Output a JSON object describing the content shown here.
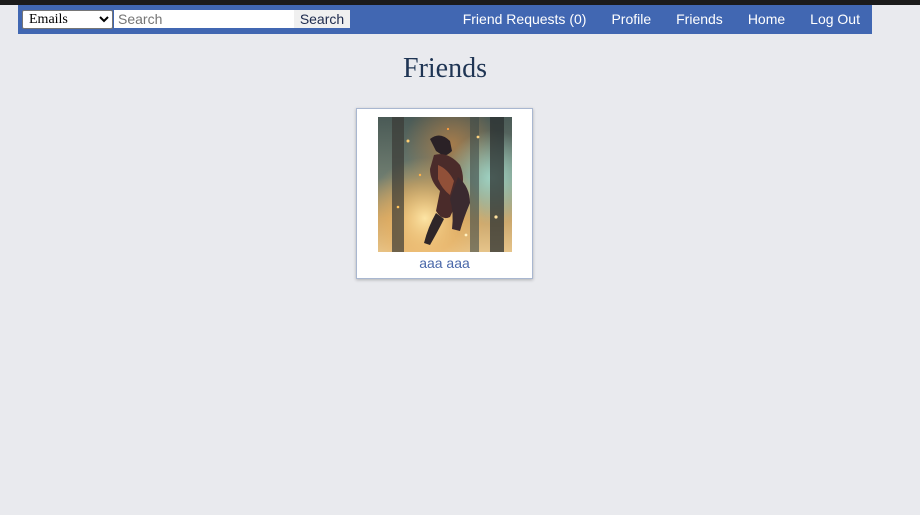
{
  "header": {
    "search": {
      "type_options": [
        "Emails"
      ],
      "selected_type": "Emails",
      "placeholder": "Search",
      "value": "",
      "button_label": "Search"
    },
    "nav": [
      {
        "label": "Friend Requests (0)"
      },
      {
        "label": "Profile"
      },
      {
        "label": "Friends"
      },
      {
        "label": "Home"
      },
      {
        "label": "Log Out"
      }
    ]
  },
  "main": {
    "title": "Friends",
    "friends": [
      {
        "name": "aaa aaa"
      }
    ]
  },
  "colors": {
    "navbar": "#4167b2",
    "background": "#e9eaee",
    "title": "#1f3554",
    "friend_link": "#4a68a9"
  }
}
